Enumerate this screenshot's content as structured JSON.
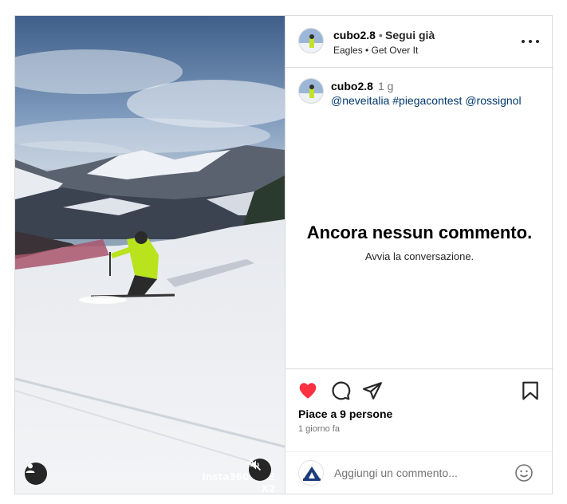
{
  "header": {
    "username": "cubo2.8",
    "dot": "•",
    "follow_label": "Segui già",
    "music_artist": "Eagles",
    "music_title": "Get Over It"
  },
  "caption": {
    "username": "cubo2.8",
    "time": "1 g",
    "tags": "@neveitalia #piegacontest @rossignol"
  },
  "comments": {
    "empty_title": "Ancora nessun commento.",
    "empty_subtitle": "Avvia la conversazione."
  },
  "actions": {
    "likes_text": "Piace a 9 persone",
    "date_text": "1 giorno fa",
    "liked": true,
    "like_color": "#ff3040"
  },
  "add_comment": {
    "placeholder": "Aggiungi un commento..."
  },
  "media": {
    "watermark_top": "SHOT",
    "watermark_bottom": "Insta360 ONE X2",
    "muted": true
  },
  "icons": [
    "tag-user-icon",
    "mute-icon",
    "more-icon",
    "heart-icon",
    "comment-icon",
    "share-icon",
    "bookmark-icon",
    "emoji-icon"
  ]
}
